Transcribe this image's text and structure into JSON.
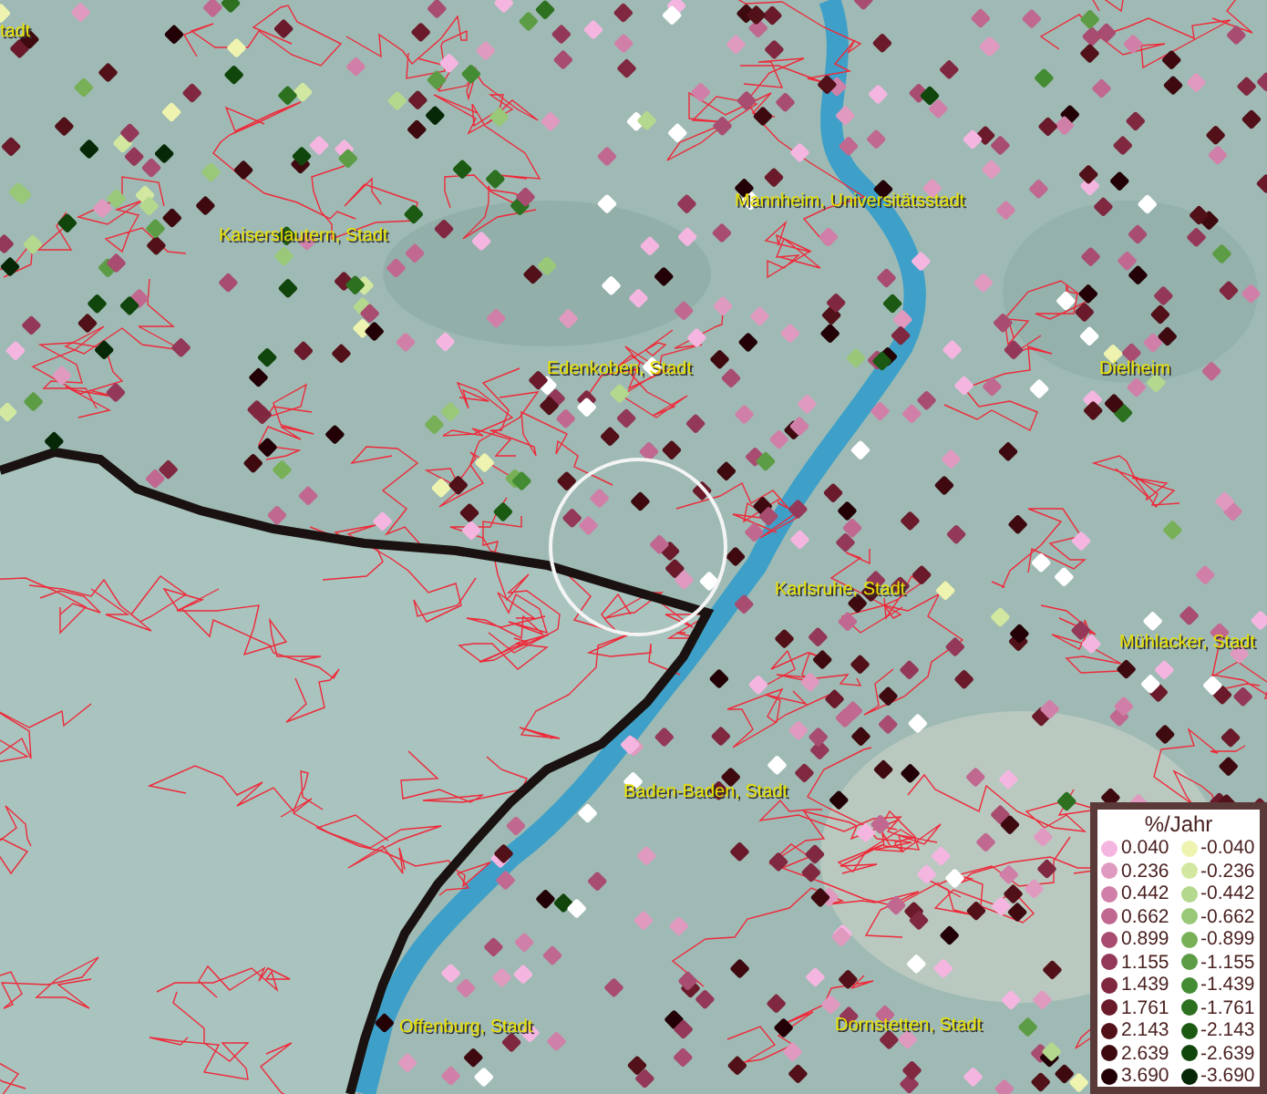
{
  "map": {
    "cities": [
      {
        "name": "tadt"
      },
      {
        "name": "Kaiserslautern, Stadt"
      },
      {
        "name": "Mannheim, Universitätsstadt"
      },
      {
        "name": "Edenkoben, Stadt"
      },
      {
        "name": "Dielheim"
      },
      {
        "name": "Karlsruhe, Stadt"
      },
      {
        "name": "Mühlacker, Stadt"
      },
      {
        "name": "Baden-Baden, Stadt"
      },
      {
        "name": "Offenburg, Stadt"
      },
      {
        "name": "Dornstetten, Stadt"
      }
    ]
  },
  "legend": {
    "title": "%/Jahr",
    "items": [
      {
        "label": "0.040",
        "color": "#f4b6e0"
      },
      {
        "label": "-0.040",
        "color": "#eef4b0"
      },
      {
        "label": "0.236",
        "color": "#e09ac0"
      },
      {
        "label": "-0.236",
        "color": "#d2e8a0"
      },
      {
        "label": "0.442",
        "color": "#d080a8"
      },
      {
        "label": "-0.442",
        "color": "#b4d88e"
      },
      {
        "label": "0.662",
        "color": "#c06890"
      },
      {
        "label": "-0.662",
        "color": "#98c878"
      },
      {
        "label": "0.899",
        "color": "#a84c70"
      },
      {
        "label": "-0.899",
        "color": "#78b058"
      },
      {
        "label": "1.155",
        "color": "#94385a"
      },
      {
        "label": "-1.155",
        "color": "#5c9c44"
      },
      {
        "label": "1.439",
        "color": "#802840"
      },
      {
        "label": "-1.439",
        "color": "#448c34"
      },
      {
        "label": "1.761",
        "color": "#6a1a2a"
      },
      {
        "label": "-1.761",
        "color": "#2c7020"
      },
      {
        "label": "2.143",
        "color": "#521018"
      },
      {
        "label": "-2.143",
        "color": "#1c5a14"
      },
      {
        "label": "2.639",
        "color": "#3e0a10"
      },
      {
        "label": "-2.639",
        "color": "#10460c"
      },
      {
        "label": "3.690",
        "color": "#220006"
      },
      {
        "label": "-3.690",
        "color": "#062806"
      }
    ]
  }
}
